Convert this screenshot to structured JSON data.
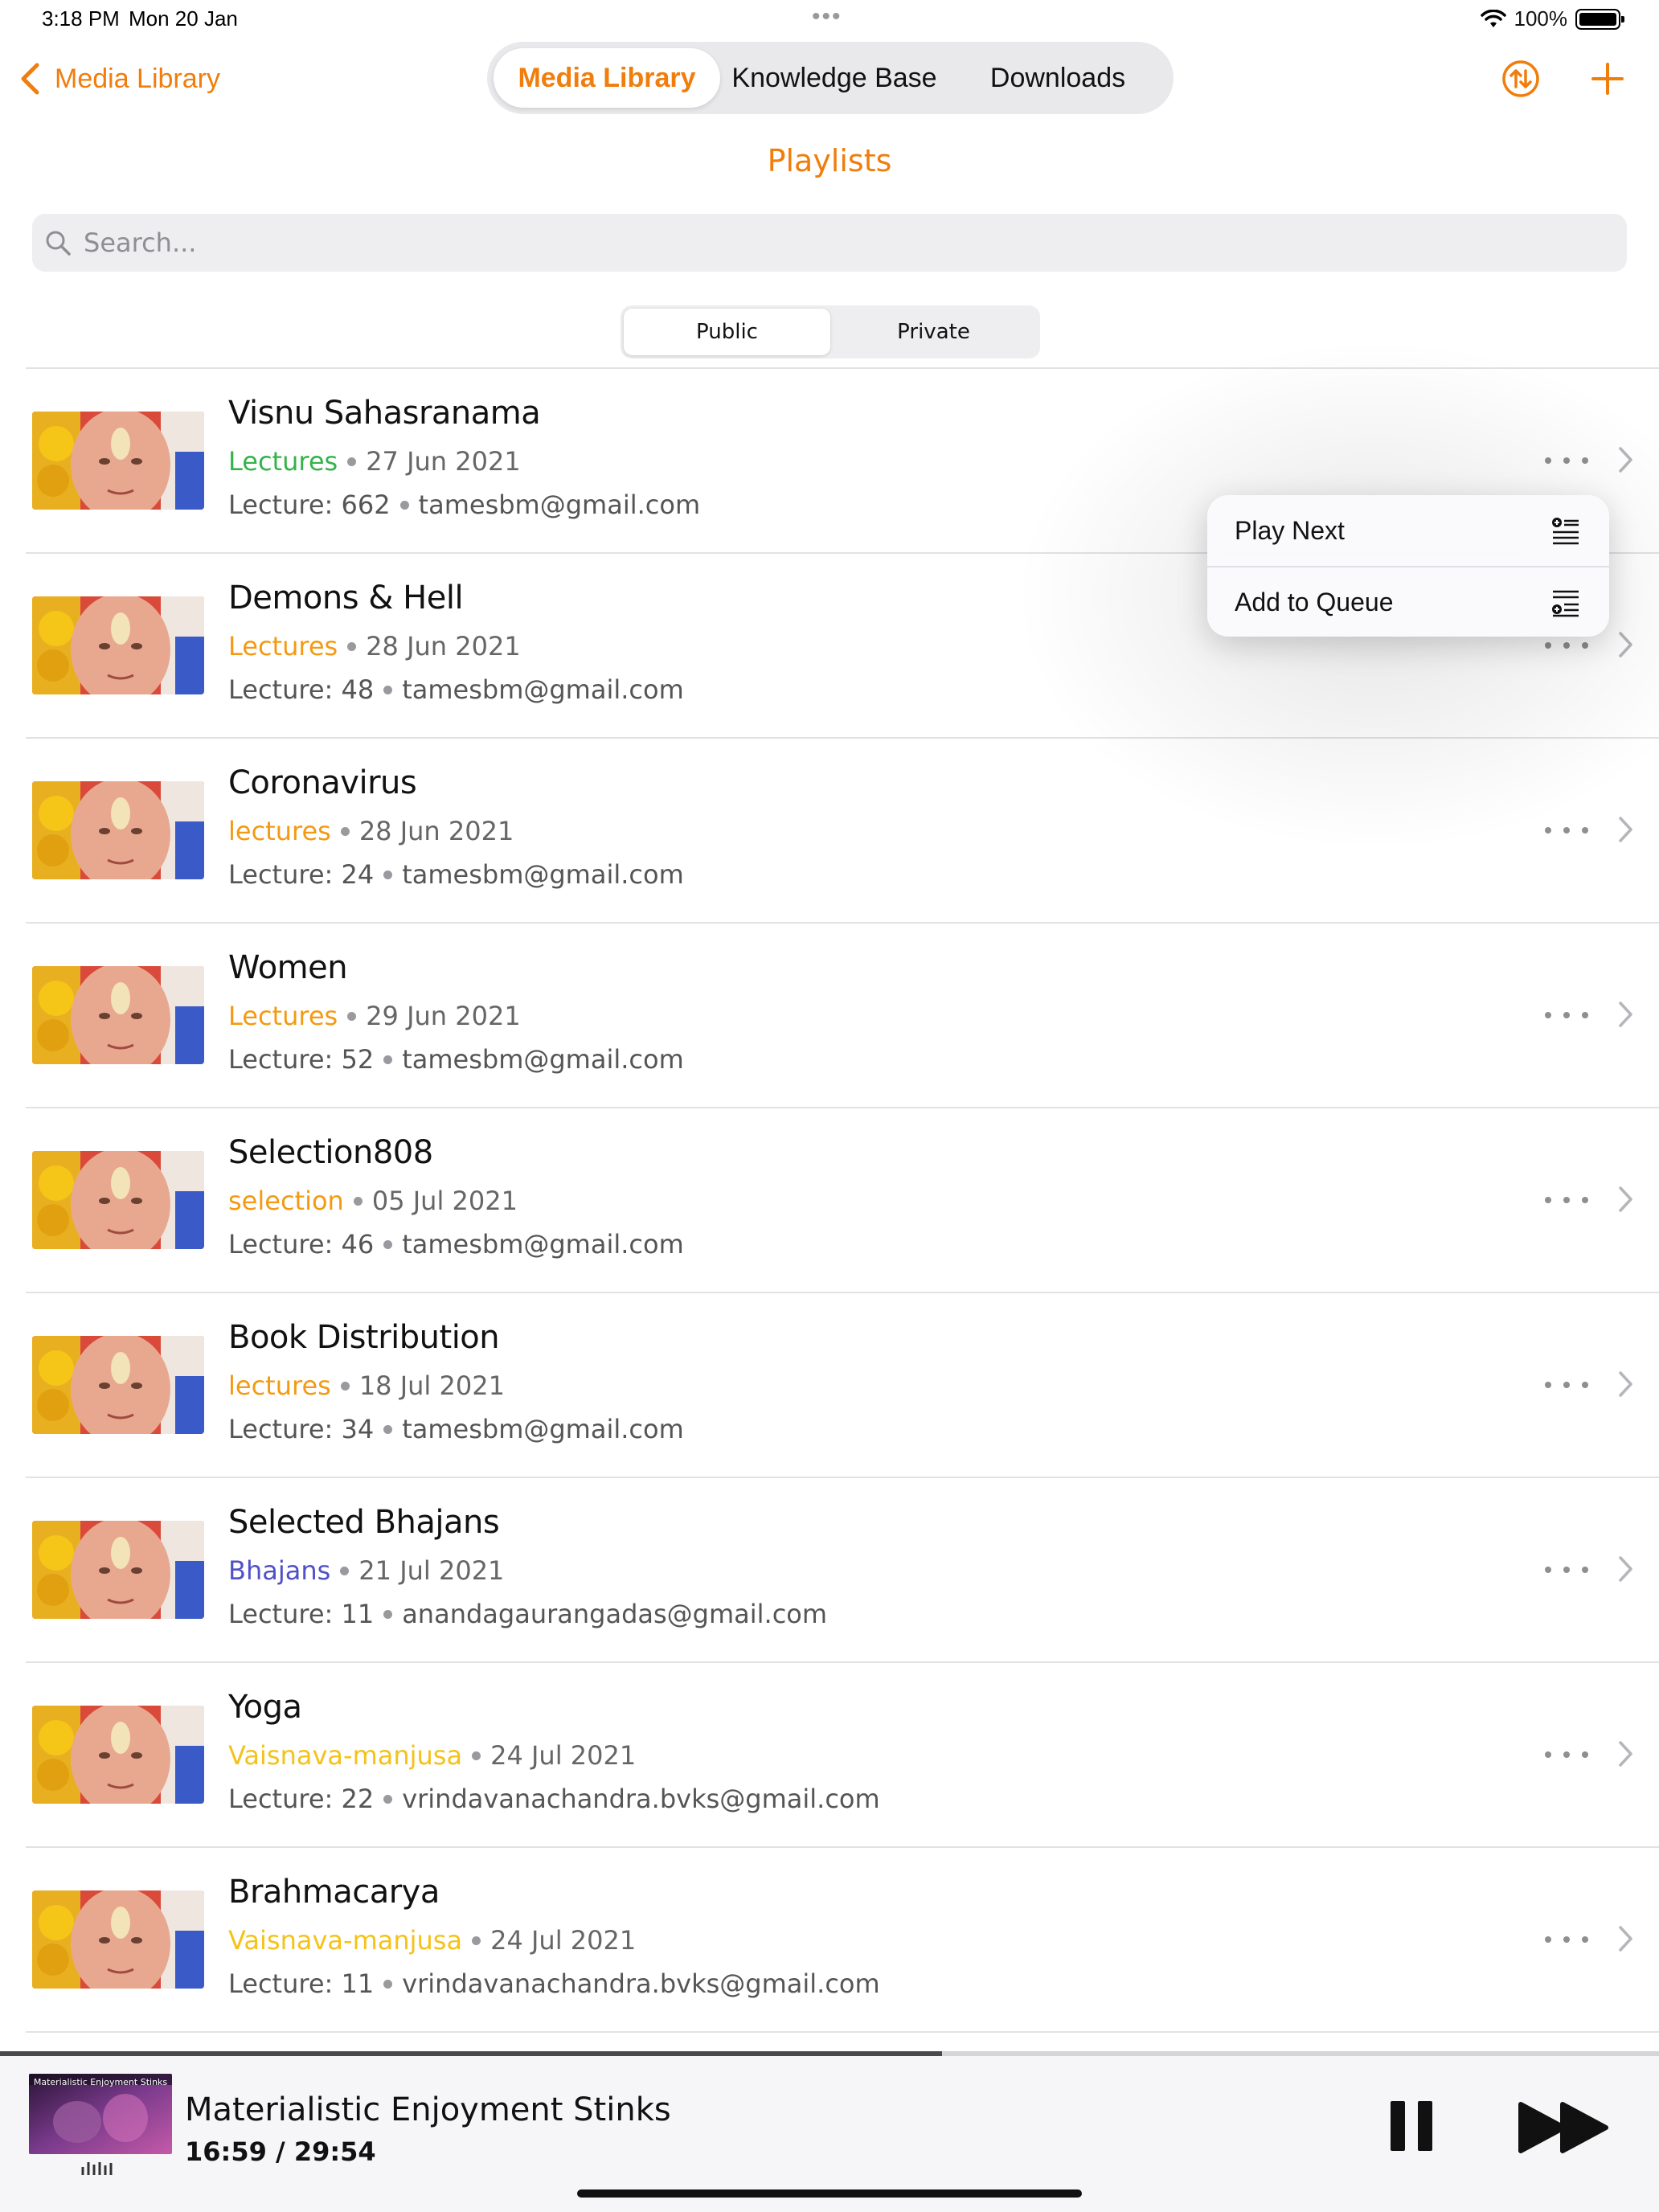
{
  "status_bar": {
    "time": "3:18 PM",
    "date": "Mon 20 Jan",
    "battery": "100%"
  },
  "nav": {
    "back_label": "Media Library",
    "tabs": [
      {
        "label": "Media Library",
        "active": true
      },
      {
        "label": "Knowledge Base",
        "active": false
      },
      {
        "label": "Downloads",
        "active": false
      }
    ],
    "sort_icon": "sort-arrows-icon",
    "add_icon": "plus-icon"
  },
  "page": {
    "title": "Playlists"
  },
  "search": {
    "placeholder": "Search..."
  },
  "visibility": {
    "options": [
      "Public",
      "Private"
    ],
    "selected": "Public"
  },
  "accent_color": "#f07d0c",
  "playlists": [
    {
      "title": "Visnu Sahasranama",
      "category": "Lectures",
      "category_color": "#34b34a",
      "date": "27 Jun 2021",
      "lectures": "Lecture: 662",
      "email": "tamesbm@gmail.com"
    },
    {
      "title": "Demons & Hell",
      "category": "Lectures",
      "category_color": "#f39a12",
      "date": "28 Jun 2021",
      "lectures": "Lecture: 48",
      "email": "tamesbm@gmail.com"
    },
    {
      "title": "Coronavirus",
      "category": "lectures",
      "category_color": "#f39a12",
      "date": "28 Jun 2021",
      "lectures": "Lecture: 24",
      "email": "tamesbm@gmail.com"
    },
    {
      "title": "Women",
      "category": "Lectures",
      "category_color": "#f39a12",
      "date": "29 Jun 2021",
      "lectures": "Lecture: 52",
      "email": "tamesbm@gmail.com"
    },
    {
      "title": "Selection808",
      "category": "selection",
      "category_color": "#f39a12",
      "date": "05 Jul 2021",
      "lectures": "Lecture: 46",
      "email": "tamesbm@gmail.com"
    },
    {
      "title": "Book Distribution",
      "category": "lectures",
      "category_color": "#f39a12",
      "date": "18 Jul 2021",
      "lectures": "Lecture: 34",
      "email": "tamesbm@gmail.com"
    },
    {
      "title": "Selected Bhajans",
      "category": "Bhajans",
      "category_color": "#5050c8",
      "date": "21 Jul 2021",
      "lectures": "Lecture: 11",
      "email": "anandagaurangadas@gmail.com"
    },
    {
      "title": "Yoga",
      "category": "Vaisnava-manjusa",
      "category_color": "#f5c21a",
      "date": "24 Jul 2021",
      "lectures": "Lecture: 22",
      "email": "vrindavanachandra.bvks@gmail.com"
    },
    {
      "title": "Brahmacarya",
      "category": "Vaisnava-manjusa",
      "category_color": "#f5c21a",
      "date": "24 Jul 2021",
      "lectures": "Lecture: 11",
      "email": "vrindavanachandra.bvks@gmail.com"
    }
  ],
  "context_menu": {
    "items": [
      {
        "label": "Play Next",
        "icon": "play-next-icon"
      },
      {
        "label": "Add to Queue",
        "icon": "add-to-queue-icon"
      }
    ]
  },
  "player": {
    "art_caption": "Materialistic Enjoyment Stinks",
    "title": "Materialistic Enjoyment Stinks",
    "time": "16:59 / 29:54",
    "progress": 0.568,
    "pause_icon": "pause-icon",
    "forward_icon": "fast-forward-icon"
  }
}
